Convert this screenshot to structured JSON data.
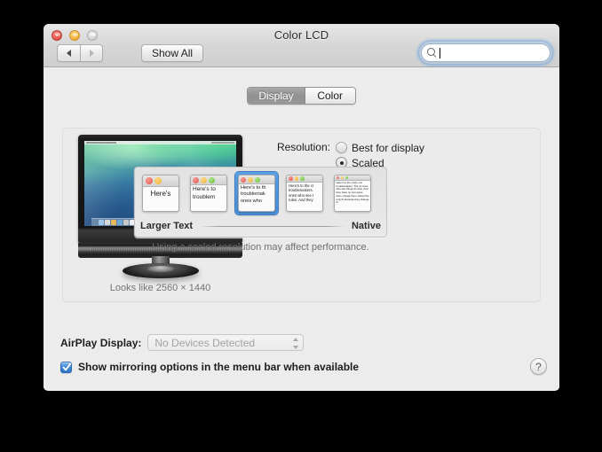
{
  "window": {
    "title": "Color LCD",
    "traffic_lights": [
      "close-button",
      "minimize-button",
      "zoom-button"
    ],
    "toolbar": {
      "back_icon": "triangle-left-icon",
      "forward_icon": "triangle-right-icon",
      "show_all_label": "Show All",
      "search": {
        "placeholder": "",
        "value": "",
        "icon": "search-icon",
        "focused": true
      }
    }
  },
  "tabs": [
    {
      "label": "Display",
      "selected": true
    },
    {
      "label": "Color",
      "selected": false
    }
  ],
  "preview": {
    "caption": "Looks like 2560 × 1440",
    "monitor_icon": "external-display-icon",
    "wallpaper": "mavericks-wave-wallpaper",
    "dock_icon_colors": [
      "#9fc8e8",
      "#d8d8d8",
      "#e8ba5a",
      "#6fa8d8",
      "#c8c8c8",
      "#efefef",
      "#8fb8d8",
      "#e8e0c0",
      "#5a9ad0",
      "#d8e8f0",
      "#f0c060",
      "#c83c2c",
      "#4a8ac0",
      "#b8d8e8",
      "#e0e8f0",
      "#7ab0d8",
      "#d0d8e0",
      "#e8c870",
      "#9ec6e4",
      "#cfd9e2"
    ]
  },
  "resolution": {
    "label": "Resolution:",
    "options": [
      {
        "label": "Best for display",
        "selected": false
      },
      {
        "label": "Scaled",
        "selected": true
      }
    ],
    "scaled_thumbnails": [
      {
        "name": "thumb-larger-text",
        "text": "Here's",
        "selected": false,
        "dots": 2,
        "scale": "s1"
      },
      {
        "name": "thumb-scale-2",
        "text": "Here's to troublem",
        "selected": false,
        "dots": 3,
        "scale": "s2"
      },
      {
        "name": "thumb-scale-3",
        "text": "Here's to th troublemak ones who",
        "selected": true,
        "dots": 3,
        "scale": "s3"
      },
      {
        "name": "thumb-scale-4",
        "text": "Here's to the cr troublemakers. ones who see t rules. And they",
        "selected": false,
        "dots": 3,
        "scale": "s4"
      },
      {
        "name": "thumb-native",
        "text": "Here's to the crazy one troublemakers. The mi ones who see things di rules. And they have no can quote them, disagr them. About the only th because they change th",
        "selected": false,
        "dots": 3,
        "scale": "s5"
      }
    ],
    "legend_left": "Larger Text",
    "legend_right": "Native",
    "performance_note": "Using a scaled resolution may affect performance."
  },
  "airplay": {
    "label": "AirPlay Display:",
    "value": "No Devices Detected",
    "disabled": true,
    "stepper_icon": "stepper-arrows-icon"
  },
  "mirroring": {
    "label": "Show mirroring options in the menu bar when available",
    "checked": true,
    "check_icon": "checkmark-icon"
  },
  "help": {
    "label": "?",
    "icon": "question-mark-icon"
  },
  "colors": {
    "accent_blue": "#4a8fd8",
    "checkbox_blue": "#3d84d4",
    "window_bg": "#ececec",
    "panel_bg": "#ebebeb",
    "desktop_bg": "#000000"
  }
}
